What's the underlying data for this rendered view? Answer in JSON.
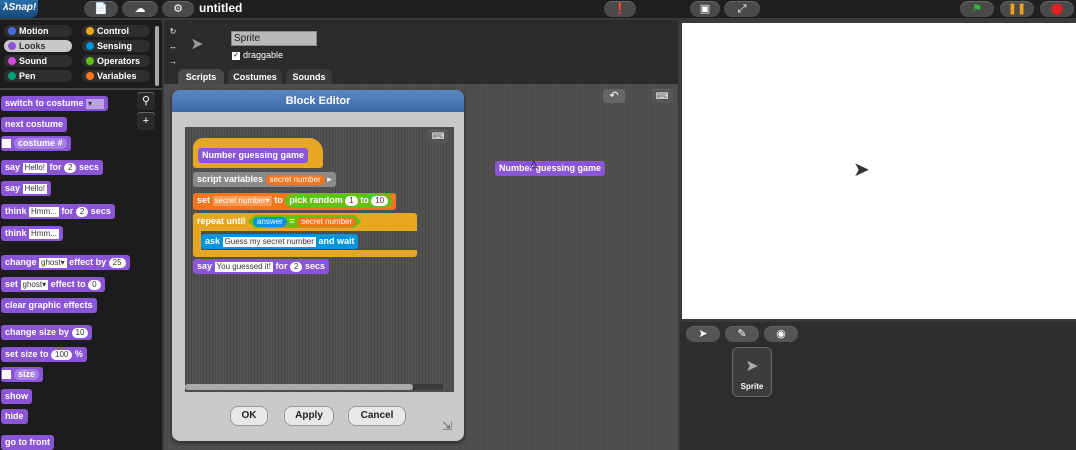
{
  "app": {
    "logo": "λSnap!",
    "project_title": "untitled"
  },
  "categories": [
    {
      "label": "Motion",
      "color": "#4a6cd4",
      "selected": false
    },
    {
      "label": "Control",
      "color": "#e6a822",
      "selected": false
    },
    {
      "label": "Looks",
      "color": "#8a55d7",
      "selected": true
    },
    {
      "label": "Sensing",
      "color": "#0494dc",
      "selected": false
    },
    {
      "label": "Sound",
      "color": "#cf4ad9",
      "selected": false
    },
    {
      "label": "Operators",
      "color": "#62c213",
      "selected": false
    },
    {
      "label": "Pen",
      "color": "#00a178",
      "selected": false
    },
    {
      "label": "Variables",
      "color": "#f3761d",
      "selected": false
    }
  ],
  "palette": {
    "switch_costume": "switch to costume",
    "next_costume": "next costume",
    "costume_num": "costume #",
    "say": "say",
    "say_hello": "Hello!",
    "for": "for",
    "secs": "secs",
    "two": "2",
    "think": "think",
    "think_hmm": "Hmm...",
    "change": "change",
    "ghost": "ghost",
    "effect_by": "effect by",
    "twentyfive": "25",
    "set": "set",
    "effect_to": "effect to",
    "zero": "0",
    "clear_effects": "clear graphic effects",
    "change_size": "change size by",
    "ten": "10",
    "set_size": "set size to",
    "hundred": "100",
    "percent": "%",
    "size": "size",
    "show": "show",
    "hide": "hide",
    "go_to_front": "go to front"
  },
  "sprite": {
    "name": "Sprite",
    "draggable": "draggable"
  },
  "tabs": [
    "Scripts",
    "Costumes",
    "Sounds"
  ],
  "floating_block": "Number guessing game",
  "dialog": {
    "title": "Block Editor",
    "hat": "Number guessing game",
    "script_variables": "script variables",
    "secret_number": "secret number",
    "set": "set",
    "secret_var": "secret number",
    "to": "to",
    "pick_random": "pick random",
    "one": "1",
    "ten": "10",
    "repeat_until": "repeat until",
    "answer": "answer",
    "eq": "=",
    "ask": "ask",
    "ask_text": "Guess my secret number",
    "and_wait": "and wait",
    "say": "say",
    "say_text": "You guessed it!",
    "for": "for",
    "two": "2",
    "secs": "secs",
    "ok": "OK",
    "apply": "Apply",
    "cancel": "Cancel"
  },
  "corral": {
    "sprite_label": "Sprite"
  }
}
